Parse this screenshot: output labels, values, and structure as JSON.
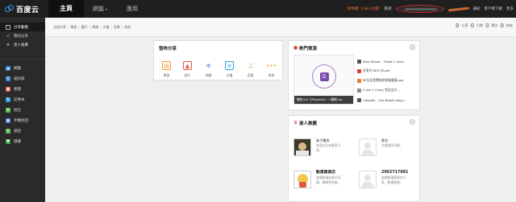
{
  "brand": {
    "name": "百度云"
  },
  "nav": {
    "tabs": [
      {
        "label": "主頁"
      },
      {
        "label": "網盤"
      },
      {
        "label": "應用"
      }
    ]
  },
  "top_right": {
    "promo": "新特權: 小米入住雲!",
    "account": "帳號",
    "links": [
      "通知",
      "客戶端下載",
      "更多"
    ]
  },
  "sidebar": {
    "primary": [
      {
        "label": "分享動態",
        "icon": "share-feed-icon"
      },
      {
        "label": "我的分享",
        "icon": "my-share-icon"
      },
      {
        "label": "達人推薦",
        "icon": "expert-icon"
      }
    ],
    "apps": [
      {
        "label": "網盤",
        "icon": "cloud-drive-icon",
        "color": "#3b8fd8"
      },
      {
        "label": "通訊錄",
        "icon": "contacts-icon",
        "color": "#2b7bd1"
      },
      {
        "label": "相冊",
        "icon": "album-icon",
        "color": "#e4513b"
      },
      {
        "label": "記事本",
        "icon": "notebook-icon",
        "color": "#3b9ee8"
      },
      {
        "label": "短信",
        "icon": "sms-icon",
        "color": "#52b74b"
      },
      {
        "label": "手機找回",
        "icon": "phone-find-icon",
        "color": "#4a7ed6"
      },
      {
        "label": "通話",
        "icon": "call-icon",
        "color": "#56b64a"
      },
      {
        "label": "健康",
        "icon": "health-icon",
        "color": "#3aa547"
      }
    ]
  },
  "filters": [
    "全部分享",
    "單頁",
    "圖片",
    "視頻",
    "文檔",
    "音樂",
    "其他"
  ],
  "counts": [
    {
      "num": "0",
      "label": "分享"
    },
    {
      "num": "0",
      "label": "訂閱"
    },
    {
      "num": "0",
      "label": "關注"
    },
    {
      "num": "0",
      "label": "粉絲"
    }
  ],
  "share_panel": {
    "title": "發佈分享",
    "items": [
      {
        "label": "單頁",
        "icon": "page-icon",
        "color": "#f39a2b"
      },
      {
        "label": "圖片",
        "icon": "image-icon",
        "color": "#e6534a"
      },
      {
        "label": "視頻",
        "icon": "video-icon",
        "color": "#3b82d6"
      },
      {
        "label": "文檔",
        "icon": "doc-icon",
        "color": "#2ea3d8"
      },
      {
        "label": "音樂",
        "icon": "music-icon",
        "color": "#8cc63f"
      },
      {
        "label": "其他",
        "icon": "more-icon",
        "color": "#f0a020"
      }
    ]
  },
  "hot_panel": {
    "title": "熱門資源",
    "preview_caption": "備份3.6（iPhone4s）一鍵刷.rar",
    "items": [
      {
        "label": "Nine Muses - Ticket + Doll...",
        "color": "#555"
      },
      {
        "label": "开发片783178.pdf",
        "color": "#d9403a"
      },
      {
        "label": "BT社区免费体验帮助截屏.ppt",
        "color": "#e67e22"
      },
      {
        "label": "C-ute 5 Crazy 完全全大...",
        "color": "#888"
      },
      {
        "label": "Catwalk - One Bright stay(...",
        "color": "#555"
      }
    ]
  },
  "expert_panel": {
    "title": "達人推薦",
    "people": [
      {
        "name": "妹子書房",
        "desc1": "本是此生有影原分",
        "desc2": "享。",
        "follow": ""
      },
      {
        "name": "匿名",
        "desc1": "文檔讓別刊藏。",
        "desc2": "",
        "follow": ""
      },
      {
        "name": "動漫資源店",
        "desc1": "各類動漫資源分享",
        "desc2": "鋪，情報等各類。",
        "follow": ""
      },
      {
        "name": "2902717881",
        "desc1": "各類動漫資源合分",
        "desc2": "享，動漫資源。",
        "follow": ""
      }
    ]
  }
}
